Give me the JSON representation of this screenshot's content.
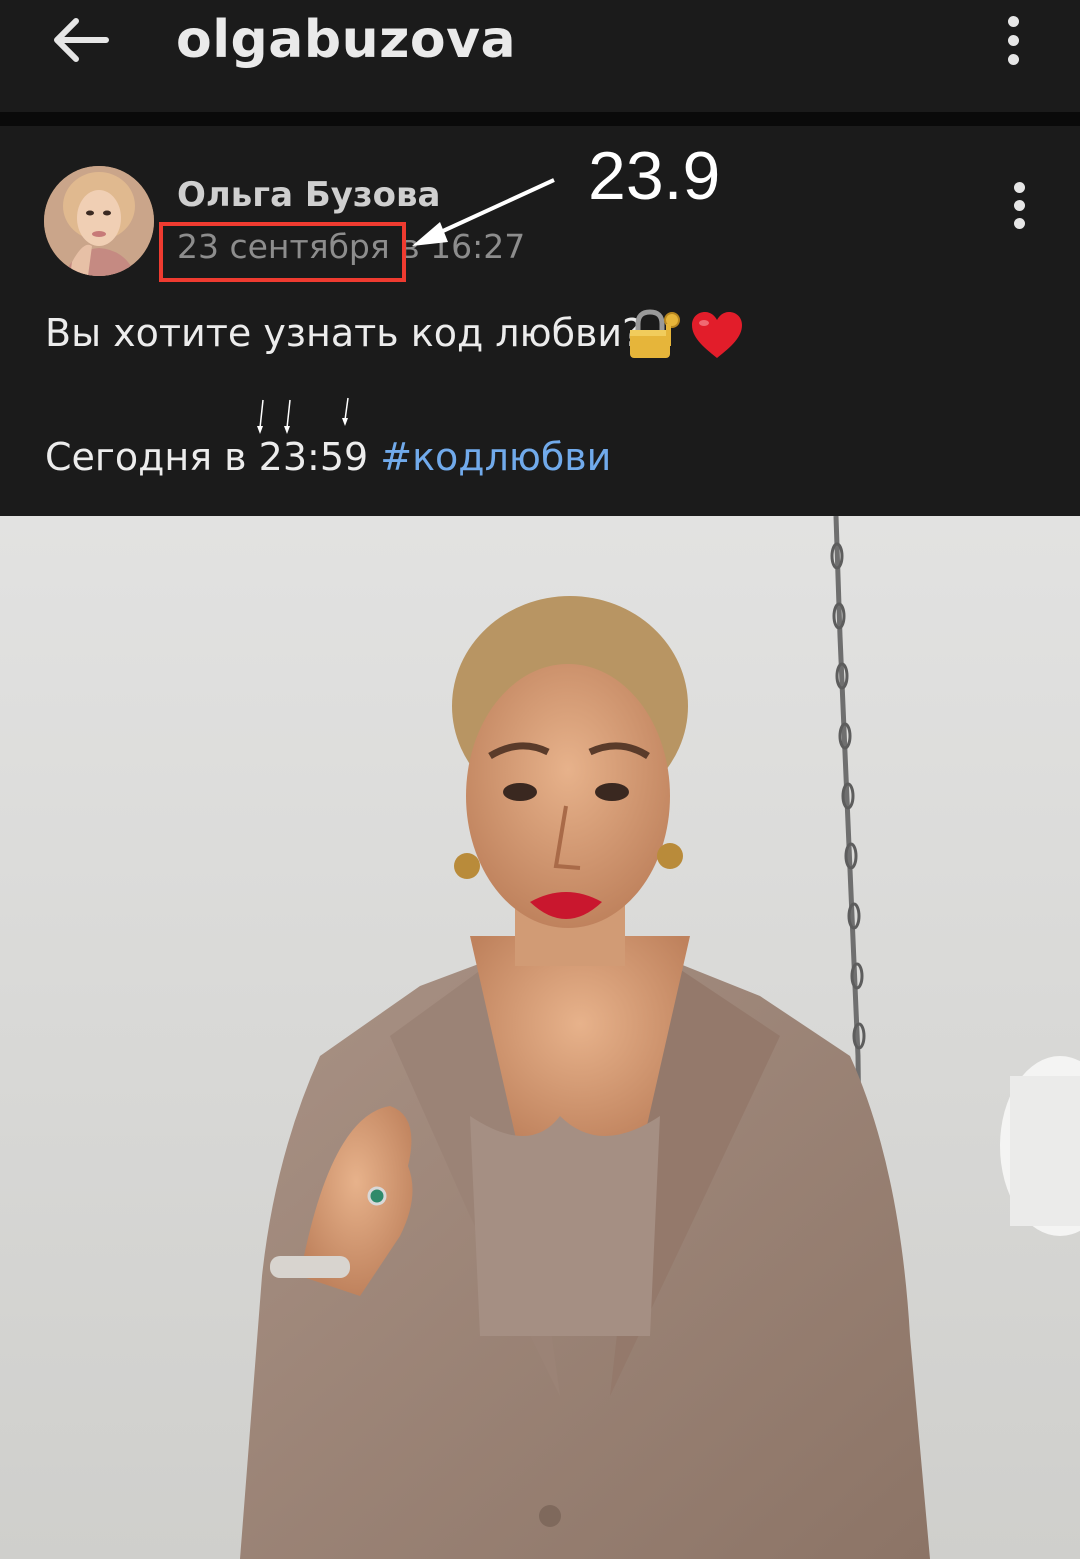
{
  "header": {
    "title": "olgabuzova",
    "back_icon": "arrow-left-icon",
    "menu_icon": "more-vertical-icon"
  },
  "post": {
    "author_name": "Ольга Бузова",
    "timestamp": "23 сентября в 16:27",
    "text_line_1": "Вы хотите узнать код любви?",
    "emoji_1": "locked-with-key-icon",
    "emoji_2": "red-heart-icon",
    "text_line_2": "Сегодня в 23:59",
    "hashtag": "#кодлюбви",
    "menu_icon": "more-vertical-icon"
  },
  "annotation": {
    "label": "23.9",
    "highlight_color": "#ef3b30"
  },
  "colors": {
    "background": "#1b1b1b",
    "link": "#71aaeb",
    "muted_text": "#8d8d8d"
  }
}
